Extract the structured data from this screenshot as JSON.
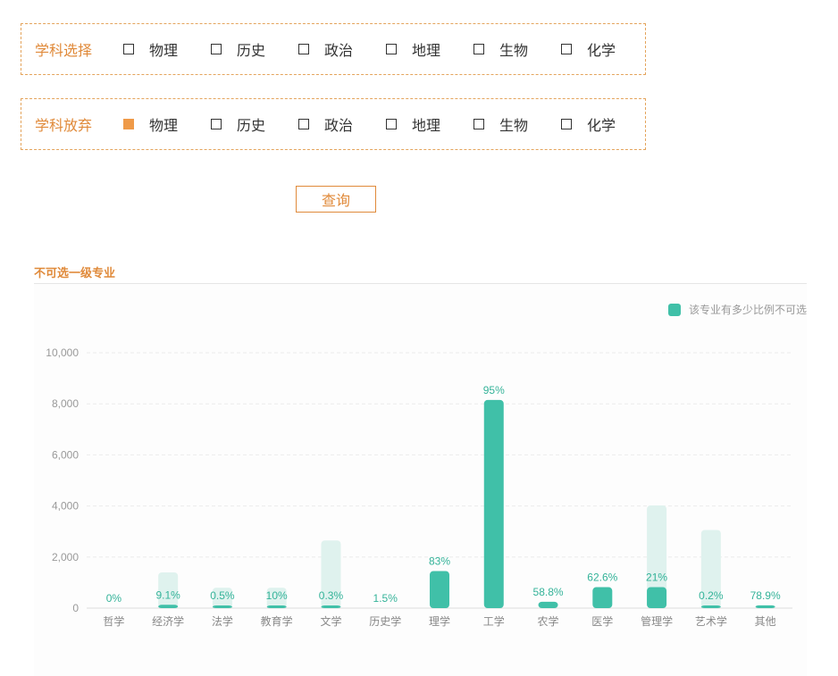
{
  "filters": {
    "select_row": {
      "label": "学科选择",
      "options": [
        {
          "label": "物理",
          "checked": false
        },
        {
          "label": "历史",
          "checked": false
        },
        {
          "label": "政治",
          "checked": false
        },
        {
          "label": "地理",
          "checked": false
        },
        {
          "label": "生物",
          "checked": false
        },
        {
          "label": "化学",
          "checked": false
        }
      ]
    },
    "abandon_row": {
      "label": "学科放弃",
      "options": [
        {
          "label": "物理",
          "checked": true
        },
        {
          "label": "历史",
          "checked": false
        },
        {
          "label": "政治",
          "checked": false
        },
        {
          "label": "地理",
          "checked": false
        },
        {
          "label": "生物",
          "checked": false
        },
        {
          "label": "化学",
          "checked": false
        }
      ]
    },
    "query_button": "查询"
  },
  "section": {
    "tab_label": "不可选一级专业"
  },
  "colors": {
    "accent_orange": "#e08a3a",
    "checked_fill": "#ef9a48",
    "bar_main": "#40c0a8",
    "bar_background": "#dff2ee",
    "label_green": "#34b399"
  },
  "chart_data": {
    "type": "bar",
    "categories": [
      "哲学",
      "经济学",
      "法学",
      "教育学",
      "文学",
      "历史学",
      "理学",
      "工学",
      "农学",
      "医学",
      "管理学",
      "艺术学",
      "其他"
    ],
    "series": [
      {
        "name": "该专业有多少比例不可选",
        "values": [
          0,
          130,
          5,
          80,
          8,
          0,
          1450,
          8150,
          250,
          820,
          820,
          5,
          110
        ]
      }
    ],
    "background_values": [
      0,
      1400,
      800,
      800,
      2650,
      0,
      0,
      0,
      0,
      0,
      4020,
      3060,
      0
    ],
    "data_labels": [
      "0%",
      "9.1%",
      "0.5%",
      "10%",
      "0.3%",
      "1.5%",
      "83%",
      "95%",
      "58.8%",
      "62.6%",
      "21%",
      "0.2%",
      "78.9%"
    ],
    "ylim": [
      0,
      10000
    ],
    "yticks": [
      0,
      2000,
      4000,
      6000,
      8000,
      10000
    ],
    "ytick_labels": [
      "0",
      "2,000",
      "4,000",
      "6,000",
      "8,000",
      "10,000"
    ],
    "legend": {
      "label": "该专业有多少比例不可选",
      "position": "top-right"
    },
    "grid": true
  }
}
